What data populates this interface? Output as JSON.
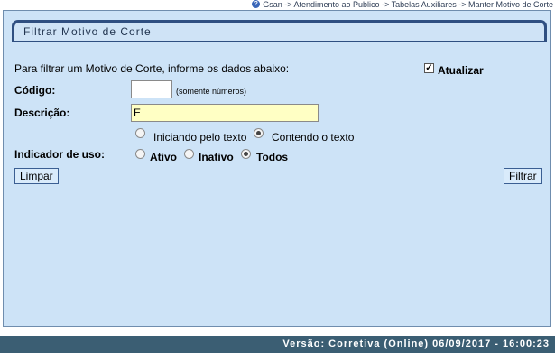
{
  "breadcrumb": {
    "icon": "help-icon",
    "text": "Gsan -> Atendimento ao Publico -> Tabelas Auxiliares -> Manter Motivo de Corte"
  },
  "panel": {
    "title": "Filtrar Motivo de Corte"
  },
  "form": {
    "instructions": "Para filtrar um Motivo de Corte, informe os dados abaixo:",
    "atualizar": {
      "label": "Atualizar",
      "checked": true
    },
    "codigo": {
      "label": "Código:",
      "value": "",
      "hint": "(somente números)"
    },
    "descricao": {
      "label": "Descrição:",
      "value": "E"
    },
    "descricao_mode": {
      "options": [
        "Iniciando pelo texto",
        "Contendo o texto"
      ],
      "selected": "Contendo o texto"
    },
    "indicador_uso": {
      "label": "Indicador de uso:",
      "options": [
        "Ativo",
        "Inativo",
        "Todos"
      ],
      "selected": "Todos"
    },
    "limpar_label": "Limpar",
    "filtrar_label": "Filtrar"
  },
  "footer": {
    "version": "Versão: Corretiva (Online) 06/09/2017 - 16:00:23"
  },
  "colors": {
    "panel_bg": "#cde3f7",
    "title_bar": "#2f4f81",
    "footer_bg": "#3b5e73",
    "input_highlight": "#ffffc4"
  }
}
